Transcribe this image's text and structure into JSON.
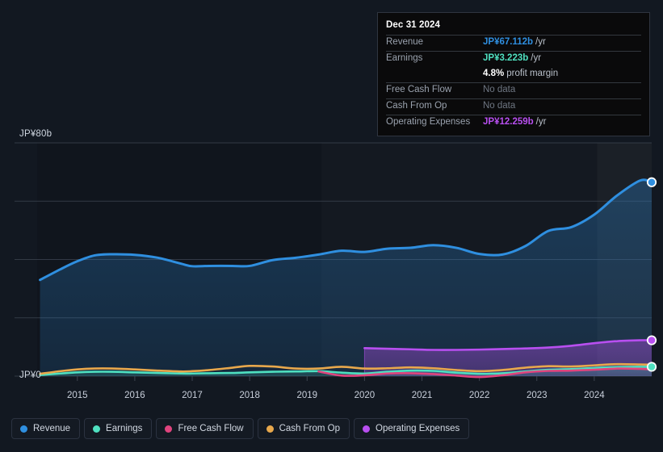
{
  "tooltip": {
    "title": "Dec 31 2024",
    "rows": [
      {
        "label": "Revenue",
        "value": "JP¥67.112b",
        "suffix": "/yr",
        "color": "#2f8fe0",
        "nodata": false
      },
      {
        "label": "Earnings",
        "value": "JP¥3.223b",
        "suffix": "/yr",
        "color": "#4fe0c0",
        "nodata": false
      },
      {
        "label": "",
        "value": "4.8%",
        "suffix": "profit margin",
        "color": "#ffffff",
        "nodata": false
      },
      {
        "label": "Free Cash Flow",
        "value": "No data",
        "suffix": "",
        "color": "#6e7682",
        "nodata": true
      },
      {
        "label": "Cash From Op",
        "value": "No data",
        "suffix": "",
        "color": "#6e7682",
        "nodata": true
      },
      {
        "label": "Operating Expenses",
        "value": "JP¥12.259b",
        "suffix": "/yr",
        "color": "#b84ff0",
        "nodata": false
      }
    ]
  },
  "axis": {
    "y_top_label": "JP¥80b",
    "y_zero_label": "JP¥0",
    "x_labels": [
      "2015",
      "2016",
      "2017",
      "2018",
      "2019",
      "2020",
      "2021",
      "2022",
      "2023",
      "2024"
    ]
  },
  "legend": {
    "items": [
      {
        "label": "Revenue",
        "color": "#2f8fe0"
      },
      {
        "label": "Earnings",
        "color": "#4fe0c0"
      },
      {
        "label": "Free Cash Flow",
        "color": "#e0447e"
      },
      {
        "label": "Cash From Op",
        "color": "#e8a84c"
      },
      {
        "label": "Operating Expenses",
        "color": "#b84ff0"
      }
    ]
  },
  "chart_data": {
    "type": "area",
    "title": "",
    "xlabel": "",
    "ylabel": "JP¥ (billions)",
    "ylim": [
      0,
      80
    ],
    "xlim": [
      2014.3,
      2025.0
    ],
    "yticks": [
      0,
      20,
      40,
      60,
      80
    ],
    "ytick_labels": [
      "JP¥0",
      "",
      "",
      "",
      "JP¥80b"
    ],
    "grid": true,
    "legend_position": "bottom-left",
    "currency": "JP¥",
    "unit": "b",
    "x": [
      2014.35,
      2014.7,
      2015.0,
      2015.3,
      2015.6,
      2016.0,
      2016.4,
      2016.8,
      2017.0,
      2017.3,
      2017.7,
      2018.0,
      2018.4,
      2018.8,
      2019.2,
      2019.6,
      2020.0,
      2020.4,
      2020.8,
      2021.2,
      2021.6,
      2022.0,
      2022.4,
      2022.8,
      2023.2,
      2023.6,
      2024.0,
      2024.4,
      2024.8,
      2025.0
    ],
    "series": [
      {
        "name": "Revenue",
        "color": "#2f8fe0",
        "fill": true,
        "values": [
          33.0,
          36.6,
          39.4,
          41.4,
          41.8,
          41.6,
          40.6,
          38.6,
          37.7,
          37.8,
          37.8,
          37.8,
          39.8,
          40.6,
          41.7,
          43.0,
          42.6,
          43.7,
          44.0,
          44.9,
          44.0,
          41.9,
          41.7,
          44.6,
          49.8,
          51.1,
          55.4,
          62.0,
          67.1,
          66.5
        ],
        "endpoint": {
          "value": 67.112,
          "label": "JP¥67.112b"
        }
      },
      {
        "name": "Earnings",
        "color": "#4fe0c0",
        "fill": true,
        "values": [
          0.4,
          0.9,
          1.3,
          1.5,
          1.5,
          1.3,
          1.1,
          0.9,
          0.9,
          1.0,
          1.1,
          1.3,
          1.5,
          1.6,
          1.7,
          1.2,
          0.9,
          1.5,
          1.9,
          1.8,
          1.2,
          0.8,
          1.0,
          1.6,
          2.2,
          2.4,
          2.8,
          3.1,
          3.2,
          3.2
        ],
        "endpoint": {
          "value": 3.223,
          "label": "JP¥3.223b"
        }
      },
      {
        "name": "Free Cash Flow",
        "color": "#e0447e",
        "fill": false,
        "start_x": 2019.2,
        "values": [
          null,
          null,
          null,
          null,
          null,
          null,
          null,
          null,
          null,
          null,
          null,
          null,
          null,
          null,
          1.6,
          0.2,
          0.3,
          0.9,
          1.0,
          0.7,
          0.2,
          -0.3,
          0.3,
          1.3,
          1.8,
          1.9,
          2.2,
          2.6,
          2.5,
          2.3
        ]
      },
      {
        "name": "Cash From Op",
        "color": "#e8a84c",
        "fill": false,
        "values": [
          0.8,
          1.7,
          2.3,
          2.6,
          2.6,
          2.3,
          1.9,
          1.6,
          1.7,
          2.1,
          2.9,
          3.5,
          3.3,
          2.6,
          2.6,
          3.2,
          2.6,
          2.7,
          3.0,
          2.7,
          2.1,
          1.7,
          2.1,
          2.9,
          3.4,
          3.3,
          3.7,
          4.1,
          4.0,
          3.9
        ]
      },
      {
        "name": "Operating Expenses",
        "color": "#b84ff0",
        "fill": true,
        "start_x": 2020.0,
        "values": [
          null,
          null,
          null,
          null,
          null,
          null,
          null,
          null,
          null,
          null,
          null,
          null,
          null,
          null,
          null,
          null,
          9.6,
          9.4,
          9.2,
          9.0,
          9.0,
          9.1,
          9.3,
          9.5,
          9.8,
          10.4,
          11.3,
          12.0,
          12.3,
          12.3
        ],
        "endpoint": {
          "value": 12.259,
          "label": "JP¥12.259b"
        }
      }
    ],
    "shaded_regions": [
      {
        "from": 2019.25,
        "to": 2025.0,
        "note": "estimate-band-light"
      },
      {
        "from": 2024.05,
        "to": 2025.0,
        "note": "forecast-band-lighter"
      }
    ]
  }
}
